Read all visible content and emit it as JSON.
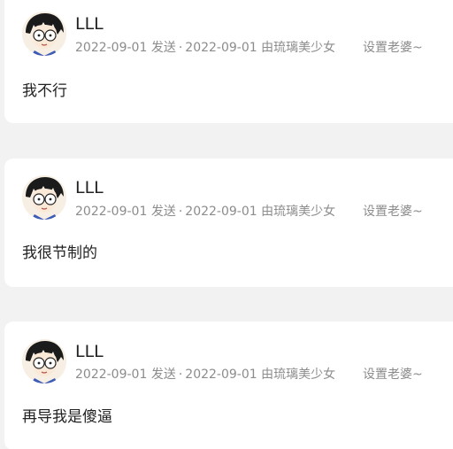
{
  "posts": [
    {
      "username": "LLL",
      "sent_date": "2022-09-01",
      "sent_label": "发送",
      "dot": "·",
      "updated_date": "2022-09-01",
      "by_label": "由琉璃美少女",
      "action_label": "设置老婆~",
      "content": "我不行",
      "avatar_icon": "anime-avatar-icon"
    },
    {
      "username": "LLL",
      "sent_date": "2022-09-01",
      "sent_label": "发送",
      "dot": "·",
      "updated_date": "2022-09-01",
      "by_label": "由琉璃美少女",
      "action_label": "设置老婆~",
      "content": "我很节制的",
      "avatar_icon": "anime-avatar-icon"
    },
    {
      "username": "LLL",
      "sent_date": "2022-09-01",
      "sent_label": "发送",
      "dot": "·",
      "updated_date": "2022-09-01",
      "by_label": "由琉璃美少女",
      "action_label": "设置老婆~",
      "content": "再导我是傻逼",
      "avatar_icon": "anime-avatar-icon"
    }
  ],
  "colors": {
    "page_background": "#f2f2f2",
    "card_background": "#ffffff",
    "primary_text": "#222222",
    "secondary_text": "#8c8c8c"
  }
}
